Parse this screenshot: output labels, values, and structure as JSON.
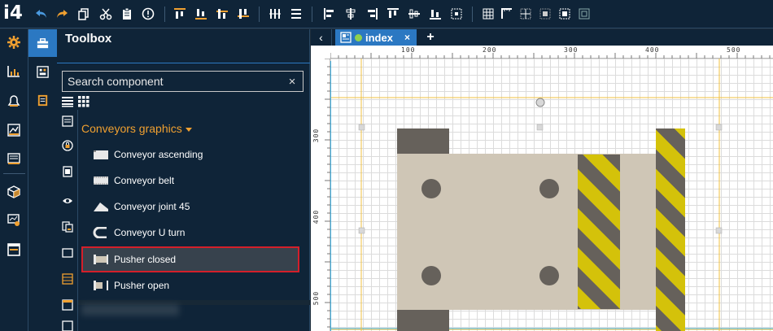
{
  "app": {
    "logo": "i4"
  },
  "toolbox": {
    "title": "Toolbox",
    "search_placeholder": "Search component",
    "search_clear": "×",
    "group": "Conveyors graphics",
    "components": [
      {
        "label": "Conveyor ascending",
        "icon": "conveyor-ascending-icon",
        "selected": false
      },
      {
        "label": "Conveyor belt",
        "icon": "conveyor-belt-icon",
        "selected": false
      },
      {
        "label": "Conveyor joint 45",
        "icon": "conveyor-joint-icon",
        "selected": false
      },
      {
        "label": "Conveyor U turn",
        "icon": "conveyor-uturn-icon",
        "selected": false
      },
      {
        "label": "Pusher closed",
        "icon": "pusher-closed-icon",
        "selected": true
      },
      {
        "label": "Pusher open",
        "icon": "pusher-open-icon",
        "selected": false
      }
    ]
  },
  "editor": {
    "back": "‹",
    "tab_label": "index",
    "tab_close": "×",
    "tab_add": "+",
    "ruler_top": [
      "100",
      "200",
      "300",
      "400",
      "500"
    ],
    "ruler_left": [
      "300",
      "400",
      "500"
    ]
  },
  "colors": {
    "accent": "#2b78c2",
    "panel": "#0f2438",
    "group_title": "#f0a030",
    "selection_border": "#d41f2a",
    "pusher_body": "#cfc6b6",
    "pusher_dark": "#66615b",
    "hazard_yellow": "#d4c20a"
  }
}
